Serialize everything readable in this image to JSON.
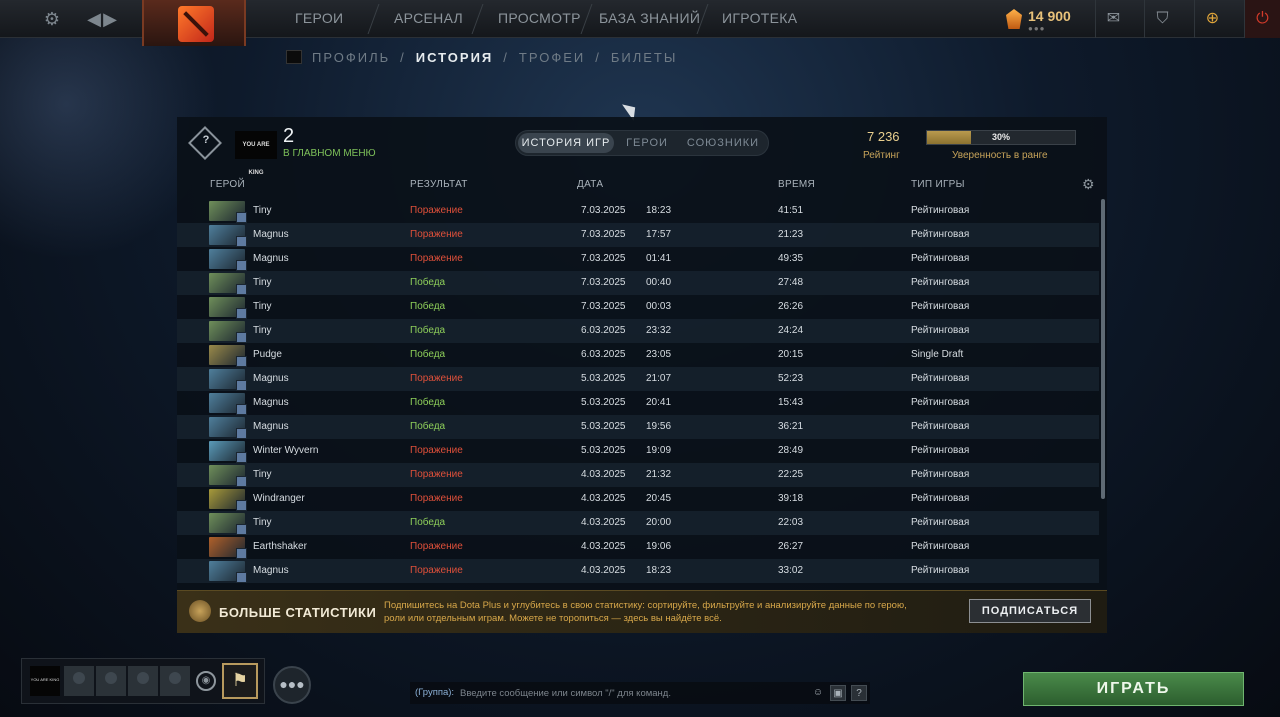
{
  "topbar": {
    "nav": [
      "ГЕРОИ",
      "АРСЕНАЛ",
      "ПРОСМОТР",
      "БАЗА ЗНАНИЙ",
      "ИГРОТЕКА"
    ],
    "gold": "14 900",
    "gold_dots": "●●●"
  },
  "subnav": {
    "items": [
      "ПРОФИЛЬ",
      "ИСТОРИЯ",
      "ТРОФЕИ",
      "БИЛЕТЫ"
    ],
    "sep": "/"
  },
  "header": {
    "rank_badge": "?",
    "player_avatar_text": "YOU ARE KING",
    "count": "2",
    "status": "В ГЛАВНОМ МЕНЮ",
    "segments": [
      "ИСТОРИЯ ИГР",
      "ГЕРОИ",
      "СОЮЗНИКИ"
    ],
    "rating_value": "7 236",
    "rating_label": "Рейтинг",
    "confidence_value": "30%",
    "confidence_fraction": 0.3,
    "confidence_label": "Уверенность в ранге"
  },
  "columns": [
    "ГЕРОЙ",
    "РЕЗУЛЬТАТ",
    "ДАТА",
    "ВРЕМЯ",
    "ТИП ИГРЫ"
  ],
  "matches": [
    {
      "hero": "Tiny",
      "result": "Поражение",
      "outcome": "loss",
      "date": "7.03.2025",
      "time": "18:23",
      "duration": "41:51",
      "type": "Рейтинговая",
      "color": "#6f8f5a"
    },
    {
      "hero": "Magnus",
      "result": "Поражение",
      "outcome": "loss",
      "date": "7.03.2025",
      "time": "17:57",
      "duration": "21:23",
      "type": "Рейтинговая",
      "color": "#4f7f9c"
    },
    {
      "hero": "Magnus",
      "result": "Поражение",
      "outcome": "loss",
      "date": "7.03.2025",
      "time": "01:41",
      "duration": "49:35",
      "type": "Рейтинговая",
      "color": "#4f7f9c"
    },
    {
      "hero": "Tiny",
      "result": "Победа",
      "outcome": "win",
      "date": "7.03.2025",
      "time": "00:40",
      "duration": "27:48",
      "type": "Рейтинговая",
      "color": "#6f8f5a"
    },
    {
      "hero": "Tiny",
      "result": "Победа",
      "outcome": "win",
      "date": "7.03.2025",
      "time": "00:03",
      "duration": "26:26",
      "type": "Рейтинговая",
      "color": "#6f8f5a"
    },
    {
      "hero": "Tiny",
      "result": "Победа",
      "outcome": "win",
      "date": "6.03.2025",
      "time": "23:32",
      "duration": "24:24",
      "type": "Рейтинговая",
      "color": "#6f8f5a"
    },
    {
      "hero": "Pudge",
      "result": "Победа",
      "outcome": "win",
      "date": "6.03.2025",
      "time": "23:05",
      "duration": "20:15",
      "type": "Single Draft",
      "color": "#9a8a4a"
    },
    {
      "hero": "Magnus",
      "result": "Поражение",
      "outcome": "loss",
      "date": "5.03.2025",
      "time": "21:07",
      "duration": "52:23",
      "type": "Рейтинговая",
      "color": "#4f7f9c"
    },
    {
      "hero": "Magnus",
      "result": "Победа",
      "outcome": "win",
      "date": "5.03.2025",
      "time": "20:41",
      "duration": "15:43",
      "type": "Рейтинговая",
      "color": "#4f7f9c"
    },
    {
      "hero": "Magnus",
      "result": "Победа",
      "outcome": "win",
      "date": "5.03.2025",
      "time": "19:56",
      "duration": "36:21",
      "type": "Рейтинговая",
      "color": "#4f7f9c"
    },
    {
      "hero": "Winter Wyvern",
      "result": "Поражение",
      "outcome": "loss",
      "date": "5.03.2025",
      "time": "19:09",
      "duration": "28:49",
      "type": "Рейтинговая",
      "color": "#5a9ab8"
    },
    {
      "hero": "Tiny",
      "result": "Поражение",
      "outcome": "loss",
      "date": "4.03.2025",
      "time": "21:32",
      "duration": "22:25",
      "type": "Рейтинговая",
      "color": "#6f8f5a"
    },
    {
      "hero": "Windranger",
      "result": "Поражение",
      "outcome": "loss",
      "date": "4.03.2025",
      "time": "20:45",
      "duration": "39:18",
      "type": "Рейтинговая",
      "color": "#a89a3a"
    },
    {
      "hero": "Tiny",
      "result": "Победа",
      "outcome": "win",
      "date": "4.03.2025",
      "time": "20:00",
      "duration": "22:03",
      "type": "Рейтинговая",
      "color": "#6f8f5a"
    },
    {
      "hero": "Earthshaker",
      "result": "Поражение",
      "outcome": "loss",
      "date": "4.03.2025",
      "time": "19:06",
      "duration": "26:27",
      "type": "Рейтинговая",
      "color": "#b0602a"
    },
    {
      "hero": "Magnus",
      "result": "Поражение",
      "outcome": "loss",
      "date": "4.03.2025",
      "time": "18:23",
      "duration": "33:02",
      "type": "Рейтинговая",
      "color": "#4f7f9c"
    }
  ],
  "promo": {
    "title": "БОЛЬШЕ СТАТИСТИКИ",
    "text": "Подпишитесь на Dota Plus и углубитесь в свою статистику: сортируйте, фильтруйте и анализируйте данные по герою, роли или отдельным играм. Можете не торопиться — здесь вы найдёте всё.",
    "button": "ПОДПИСАТЬСЯ"
  },
  "party": {
    "me_text": "YOU ARE KING"
  },
  "chat": {
    "prefix": "(Группа):",
    "placeholder": "Введите сообщение или символ \"/\" для команд.",
    "help": "?"
  },
  "play_button": "ИГРАТЬ"
}
